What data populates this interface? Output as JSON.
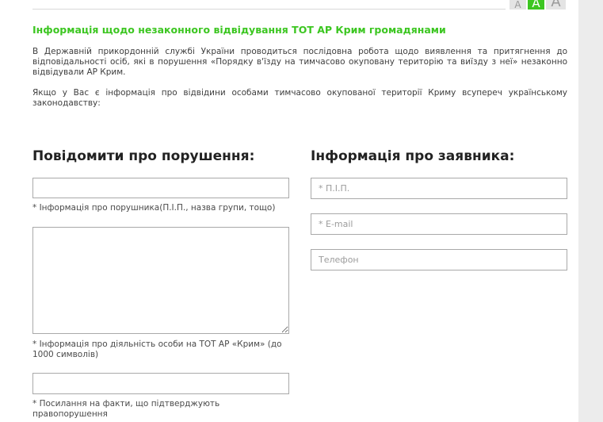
{
  "font_size_buttons": [
    "A",
    "A",
    "A"
  ],
  "title": "Інформація щодо незаконного відвідування ТОТ АР Крим громадянами",
  "intro": [
    "В Державній прикордонній службі України проводиться послідовна робота щодо виявлення та притягнення до відповідальності осіб, які в порушення «Порядку в'їзду на тимчасово окуповану територію та виїзду з неї» незаконно відвідували АР Крим.",
    "Якщо у Вас є інформація про відвідини особами тимчасово окупованої території Криму всупереч українському законодавству:"
  ],
  "report": {
    "heading": "Повідомити про порушення:",
    "violator_hint": "* Інформація про порушника(П.І.П., назва групи, тощо)",
    "activity_hint": "* Інформація про діяльність особи на ТОТ АР «Крим» (до 1000 символів)",
    "evidence_hint": "* Посилання на факти, що підтверджують правопорушення"
  },
  "applicant": {
    "heading": "Інформація про заявника:",
    "name_placeholder": "* П.І.П.",
    "email_placeholder": "* E-mail",
    "phone_placeholder": "Телефон"
  },
  "colors": {
    "accent": "#3cc621",
    "text": "#3e3e3e",
    "border": "#a9a9a9"
  }
}
